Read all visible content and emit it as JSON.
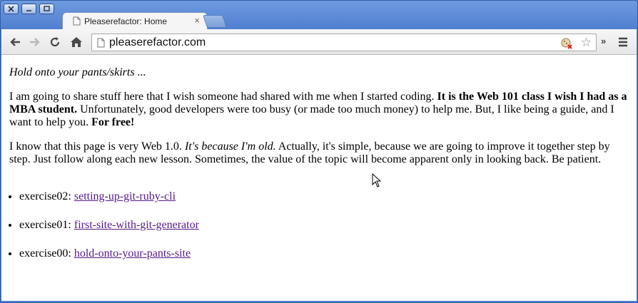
{
  "tab": {
    "title": "Pleaserefactor: Home",
    "close_glyph": "×"
  },
  "omnibox": {
    "url": "pleaserefactor.com"
  },
  "toolbar": {
    "overflow_glyph": "»"
  },
  "page": {
    "tagline": "Hold onto your pants/skirts ...",
    "intro": {
      "t1": "I am going to share stuff here that I wish someone had shared with me when I started coding. ",
      "b1": "It is the Web 101 class I wish I had as a MBA student.",
      "t2": " Unfortunately, good developers were too busy (or made too much money) to help me. But, I like being a guide, and I want to help you. ",
      "b2": "For free!"
    },
    "about": {
      "t1": "I know that this page is very Web 1.0. ",
      "i1": "It's because I'm old.",
      "t2": " Actually, it's simple, because we are going to improve it together step by step. Just follow along each new lesson. Sometimes, the value of the topic will become apparent only in looking back. Be patient."
    },
    "exercises": [
      {
        "label": "exercise02: ",
        "link": "setting-up-git-ruby-cli"
      },
      {
        "label": "exercise01: ",
        "link": "first-site-with-git-generator"
      },
      {
        "label": "exercise00: ",
        "link": "hold-onto-your-pants-site"
      }
    ]
  },
  "icons": {
    "back": "back-arrow-icon",
    "forward": "forward-arrow-icon",
    "reload": "reload-icon",
    "home": "home-icon",
    "star": "bookmark-star-icon",
    "menu": "menu-icon"
  },
  "colors": {
    "link_visited": "#551a8b",
    "frame": "#4f7fcf"
  }
}
